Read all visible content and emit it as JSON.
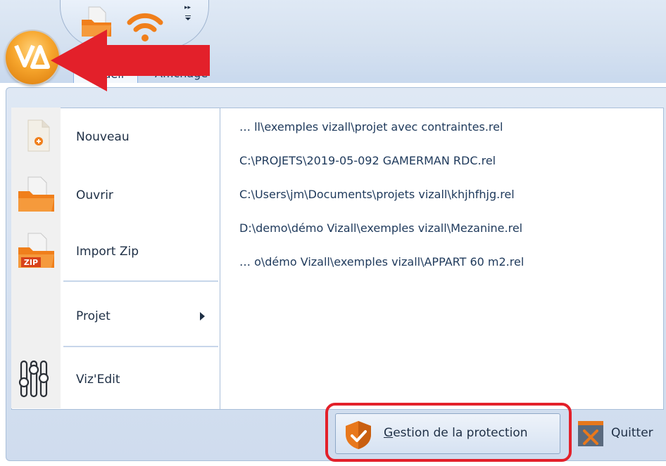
{
  "ribbon": {
    "tabs": [
      {
        "label": "Accueil"
      },
      {
        "label": "Affichage"
      }
    ],
    "quick_access_more": "▸▸"
  },
  "app_button": {
    "logo_text": "VΔ"
  },
  "menu": {
    "items": [
      {
        "label": "Nouveau",
        "icon": "new-document-icon"
      },
      {
        "label": "Ouvrir",
        "icon": "open-folder-icon"
      },
      {
        "label": "Import Zip",
        "icon": "zip-folder-icon"
      },
      {
        "label": "Projet",
        "icon": null,
        "has_submenu": true
      },
      {
        "label": "Viz'Edit",
        "icon": "sliders-icon"
      }
    ],
    "recent_files": [
      "… ll\\exemples vizall\\projet avec contraintes.rel",
      "C:\\PROJETS\\2019-05-092 GAMERMAN RDC.rel",
      "C:\\Users\\jm\\Documents\\projets vizall\\khjhfhjg.rel",
      "D:\\demo\\démo Vizall\\exemples vizall\\Mezanine.rel",
      "… o\\démo Vizall\\exemples vizall\\APPART 60 m2.rel"
    ]
  },
  "footer": {
    "protection": {
      "accesskey": "G",
      "rest": "estion de la protection"
    },
    "quit_label": "Quitter"
  },
  "colors": {
    "annotation_red": "#e3202a",
    "app_orange": "#f6a52c",
    "folder_orange": "#f07f1b",
    "shield_orange": "#e8781c"
  }
}
